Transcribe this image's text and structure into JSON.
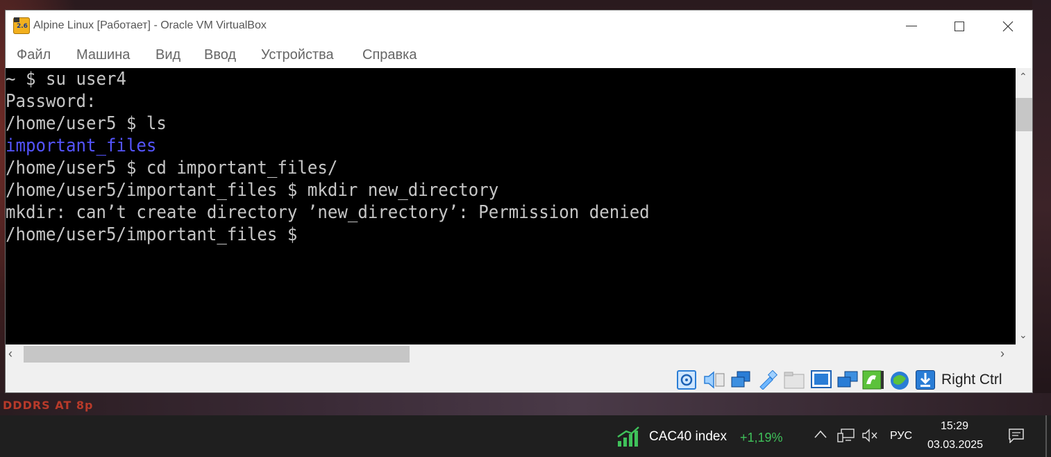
{
  "desktop": {
    "wallpaper_text": "DDDRS AT 8p"
  },
  "window": {
    "title": "Alpine Linux [Работает] - Oracle VM VirtualBox",
    "app_icon_label": "2.6"
  },
  "menu": [
    "Файл",
    "Машина",
    "Вид",
    "Ввод",
    "Устройства",
    "Справка"
  ],
  "terminal": {
    "lines": [
      {
        "text": "~ $ su user4",
        "color": "default"
      },
      {
        "text": "Password:",
        "color": "default"
      },
      {
        "text": "/home/user5 $ ls",
        "color": "default"
      },
      {
        "text": "important_files",
        "color": "blue"
      },
      {
        "text": "/home/user5 $ cd important_files/",
        "color": "default"
      },
      {
        "text": "/home/user5/important_files $ mkdir new_directory",
        "color": "default"
      },
      {
        "text": "mkdir: can’t create directory ’new_directory’: Permission denied",
        "color": "default"
      },
      {
        "text": "/home/user5/important_files $",
        "color": "default"
      }
    ],
    "colors": {
      "default": "#c6c6c6",
      "blue": "#5454ff",
      "background": "#000000"
    }
  },
  "statusbar": {
    "icons": [
      "hard-disk-icon",
      "audio-icon",
      "network-icon",
      "usb-icon",
      "shared-folders-icon",
      "display-icon",
      "video-capture-icon",
      "recording-icon",
      "cpu-icon",
      "mouse-integration-icon"
    ],
    "host_key": "Right Ctrl"
  },
  "taskbar": {
    "stock_name": "CAC40 index",
    "stock_change": "+1,19%",
    "language": "РУС",
    "time": "15:29",
    "date": "03.03.2025"
  }
}
